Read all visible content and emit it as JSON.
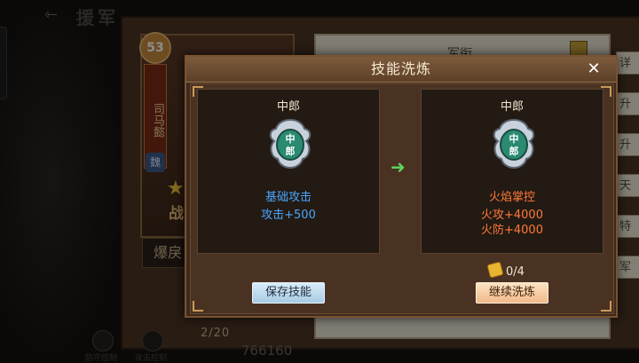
{
  "screen": {
    "back_icon": "back-arrow-icon",
    "title_partial": "援军",
    "hero": {
      "level": "53",
      "name": "司马懿",
      "faction": "魏",
      "battle_tag": "战",
      "skill_label": "爆戾"
    },
    "right_panel": {
      "tab_label": "军衔",
      "side_buttons": [
        "详",
        "升",
        "升",
        "天",
        "特",
        "军"
      ]
    },
    "bottom": {
      "count": "2/20",
      "value": "766160",
      "labels": [
        "防守控制",
        "攻击控制"
      ]
    }
  },
  "dialog": {
    "title": "技能洗炼",
    "close_label": "✕",
    "current": {
      "rank": "中郎",
      "icon_text_1": "中",
      "icon_text_2": "郎",
      "name": "基础攻击",
      "effects": [
        "攻击+500"
      ]
    },
    "new": {
      "rank": "中郎",
      "icon_text_1": "中",
      "icon_text_2": "郎",
      "name": "火焰掌控",
      "effects": [
        "火攻+4000",
        "火防+4000"
      ]
    },
    "arrow_icon": "right-arrow-icon",
    "cost": "0/4",
    "save_label": "保存技能",
    "continue_label": "继续洗炼"
  },
  "colors": {
    "current_skill_text": "#4aa6ff",
    "new_skill_text": "#ff7a3a",
    "arrow": "#5fd35a"
  }
}
